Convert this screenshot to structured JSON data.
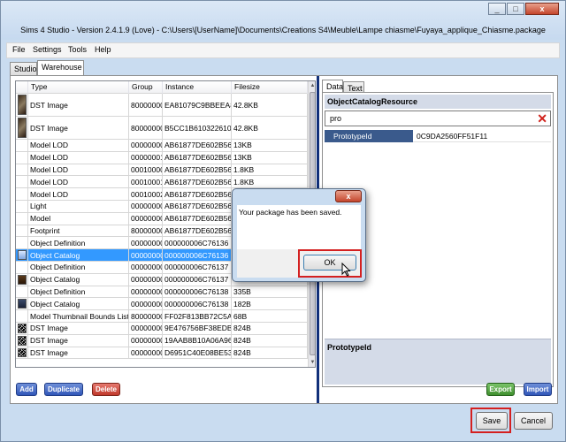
{
  "window": {
    "title": "Sims 4 Studio - Version 2.4.1.9  (Love)  - C:\\Users\\[UserName]\\Documents\\Creations S4\\Meuble\\Lampe chiasme\\Fuyaya_applique_Chiasme.package",
    "controls": [
      "_",
      "□",
      "x"
    ]
  },
  "menu": [
    "File",
    "Settings",
    "Tools",
    "Help"
  ],
  "tabs": [
    "Studio",
    "Warehouse"
  ],
  "grid": {
    "columns": [
      "Type",
      "Group",
      "Instance",
      "Filesize"
    ],
    "rows": [
      {
        "type": "DST Image",
        "group": "80000000",
        "instance": "EA81079C9BBEEA82",
        "size": "42.8KB",
        "thumb": "dark-texture"
      },
      {
        "type": "DST Image",
        "group": "80000000",
        "instance": "B5CC1B610322610D",
        "size": "42.8KB",
        "thumb": "dark-texture"
      },
      {
        "type": "Model LOD",
        "group": "00000000",
        "instance": "AB61877DE602B567",
        "size": "13KB"
      },
      {
        "type": "Model LOD",
        "group": "00000001",
        "instance": "AB61877DE602B567",
        "size": "13KB"
      },
      {
        "type": "Model LOD",
        "group": "00010000",
        "instance": "AB61877DE602B567",
        "size": "1.8KB"
      },
      {
        "type": "Model LOD",
        "group": "00010001",
        "instance": "AB61877DE602B567",
        "size": "1.8KB"
      },
      {
        "type": "Model LOD",
        "group": "00010002",
        "instance": "AB61877DE602B567",
        "size": "1.8KB"
      },
      {
        "type": "Light",
        "group": "00000000",
        "instance": "AB61877DE602B567",
        "size": ""
      },
      {
        "type": "Model",
        "group": "00000000",
        "instance": "AB61877DE602B567",
        "size": ""
      },
      {
        "type": "Footprint",
        "group": "80000000",
        "instance": "AB61877DE602B567",
        "size": ""
      },
      {
        "type": "Object Definition",
        "group": "00000000",
        "instance": "000000006C76136",
        "size": ""
      },
      {
        "type": "Object Catalog",
        "group": "00000000",
        "instance": "000000006C76136",
        "size": "",
        "selected": true,
        "thumb": "blue-swatch"
      },
      {
        "type": "Object Definition",
        "group": "00000000",
        "instance": "000000006C76137",
        "size": ""
      },
      {
        "type": "Object Catalog",
        "group": "00000000",
        "instance": "000000006C76137",
        "size": "",
        "thumb": "brown-swatch"
      },
      {
        "type": "Object Definition",
        "group": "00000000",
        "instance": "000000006C76138",
        "size": "335B"
      },
      {
        "type": "Object Catalog",
        "group": "00000000",
        "instance": "000000006C76138",
        "size": "182B",
        "thumb": "navy-swatch"
      },
      {
        "type": "Model Thumbnail Bounds List",
        "group": "80000000",
        "instance": "FF02F813BB72C5AB",
        "size": "68B"
      },
      {
        "type": "DST Image",
        "group": "00000000",
        "instance": "9E476756BF38EDB3",
        "size": "824B",
        "thumb": "noise"
      },
      {
        "type": "DST Image",
        "group": "00000000",
        "instance": "19AAB8B10A06A96E",
        "size": "824B",
        "thumb": "noise"
      },
      {
        "type": "DST Image",
        "group": "00000000",
        "instance": "D6951C40E08BE53F",
        "size": "824B",
        "thumb": "noise"
      }
    ]
  },
  "grid_buttons": {
    "add": "Add",
    "duplicate": "Duplicate",
    "delete": "Delete"
  },
  "right_tabs": [
    "Data",
    "Text"
  ],
  "properties": {
    "header": "ObjectCatalogResource",
    "search_value": "pro",
    "key": "PrototypeId",
    "value": "0C9DA2560FF51F11",
    "description_title": "PrototypeId"
  },
  "right_buttons": {
    "export": "Export",
    "import": "Import"
  },
  "footer_buttons": {
    "save": "Save",
    "cancel": "Cancel"
  },
  "dialog": {
    "close": "x",
    "message": "Your package has been saved.",
    "ok": "OK"
  },
  "colors": {
    "highlight": "#d42020",
    "selection": "#3399ff",
    "divider": "#12307a"
  }
}
